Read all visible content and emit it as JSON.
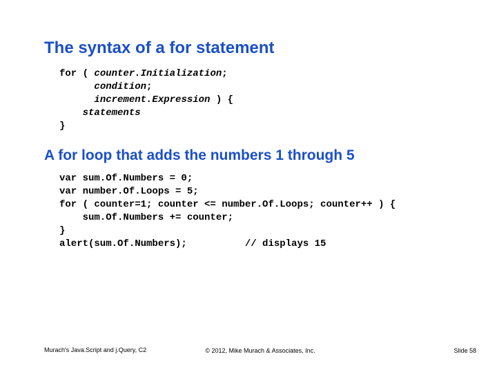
{
  "heading1": "The syntax of a for statement",
  "code1_line1_kw": "for ( ",
  "code1_line1_it": "counter.Initialization",
  "code1_line1_end": ";",
  "code1_line2_it": "condition",
  "code1_line2_end": ";",
  "code1_line3_it": "increment.Expression",
  "code1_line3_end": " ) {",
  "code1_line4_it": "statements",
  "code1_line5": "}",
  "heading2": "A for loop that adds the numbers 1 through 5",
  "code2_line1": "var sum.Of.Numbers = 0;",
  "code2_line2": "var number.Of.Loops = 5;",
  "code2_line3": "for ( counter=1; counter <= number.Of.Loops; counter++ ) {",
  "code2_line4": "    sum.Of.Numbers += counter;",
  "code2_line5": "}",
  "code2_line6": "alert(sum.Of.Numbers);          // displays 15",
  "footer_left": "Murach's Java.Script and j.Query, C2",
  "footer_center": "© 2012, Mike Murach & Associates, Inc.",
  "footer_right": "Slide 58"
}
